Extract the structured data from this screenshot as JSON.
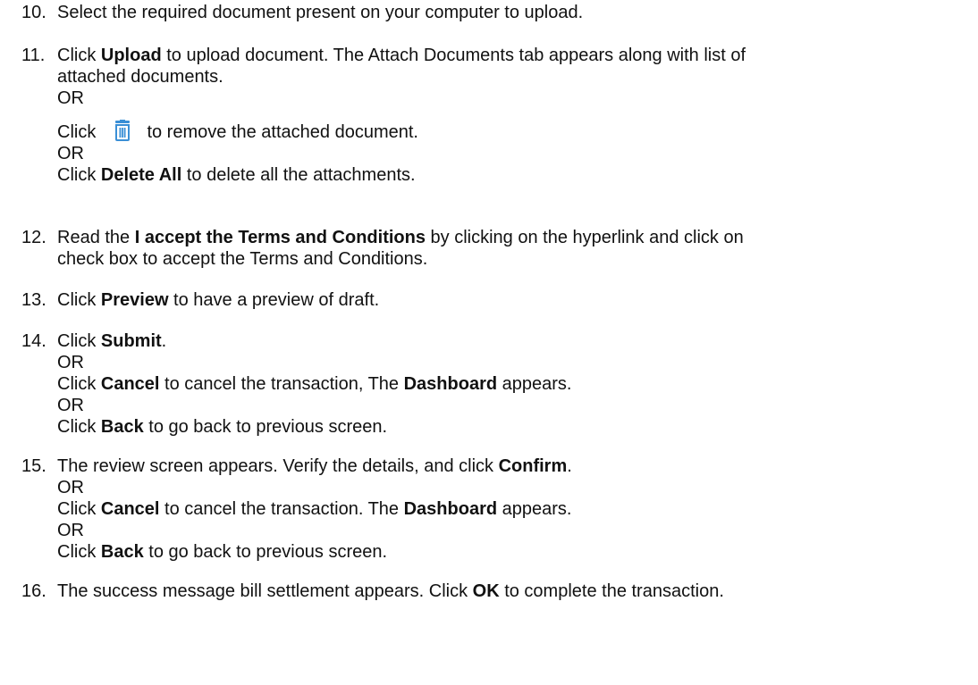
{
  "steps": [
    {
      "number": "10.",
      "lines": [
        {
          "parts": [
            "Select the required document present on your computer to upload."
          ]
        }
      ]
    },
    {
      "number": "11.",
      "lines": [
        {
          "parts": [
            "Click ",
            "Upload",
            " to upload document. The Attach Documents tab appears along with list of"
          ]
        },
        {
          "parts": [
            "attached documents."
          ]
        },
        {
          "parts": [
            "OR"
          ]
        },
        {
          "parts": [
            "Click ",
            " to remove the attached document."
          ]
        },
        {
          "parts": [
            "OR"
          ]
        },
        {
          "parts": [
            "Click ",
            "Delete All",
            " to delete all the attachments."
          ]
        }
      ]
    },
    {
      "number": "12.",
      "lines": [
        {
          "parts": [
            "Read  the ",
            "I accept the Terms and Conditions",
            " by clicking on the hyperlink and click on"
          ]
        },
        {
          "parts": [
            "check box to accept the Terms and Conditions."
          ]
        }
      ]
    },
    {
      "number": "13.",
      "lines": [
        {
          "parts": [
            "Click ",
            "Preview",
            " to have a preview of draft."
          ]
        }
      ]
    },
    {
      "number": "14.",
      "lines": [
        {
          "parts": [
            "Click ",
            "Submit",
            "."
          ]
        },
        {
          "parts": [
            "OR"
          ]
        },
        {
          "parts": [
            "Click ",
            "Cancel",
            " to cancel the transaction, The ",
            "Dashboard",
            " appears."
          ]
        },
        {
          "parts": [
            "OR"
          ]
        },
        {
          "parts": [
            "Click ",
            "Back",
            " to go back to previous screen."
          ]
        }
      ]
    },
    {
      "number": "15.",
      "lines": [
        {
          "parts": [
            "The review screen appears. Verify the details, and click ",
            "Confirm",
            "."
          ]
        },
        {
          "parts": [
            "OR"
          ]
        },
        {
          "parts": [
            "Click ",
            "Cancel",
            " to cancel the transaction. The ",
            "Dashboard",
            " appears."
          ]
        },
        {
          "parts": [
            "OR"
          ]
        },
        {
          "parts": [
            "Click ",
            "Back",
            " to go back to previous screen."
          ]
        }
      ]
    },
    {
      "number": "16.",
      "lines": [
        {
          "parts": [
            "The success message bill settlement appears. Click ",
            "OK",
            " to complete the transaction."
          ]
        }
      ]
    }
  ],
  "icons": {
    "delete_icon": "trash-can-icon",
    "delete_icon_color": "#3a8fd6"
  }
}
